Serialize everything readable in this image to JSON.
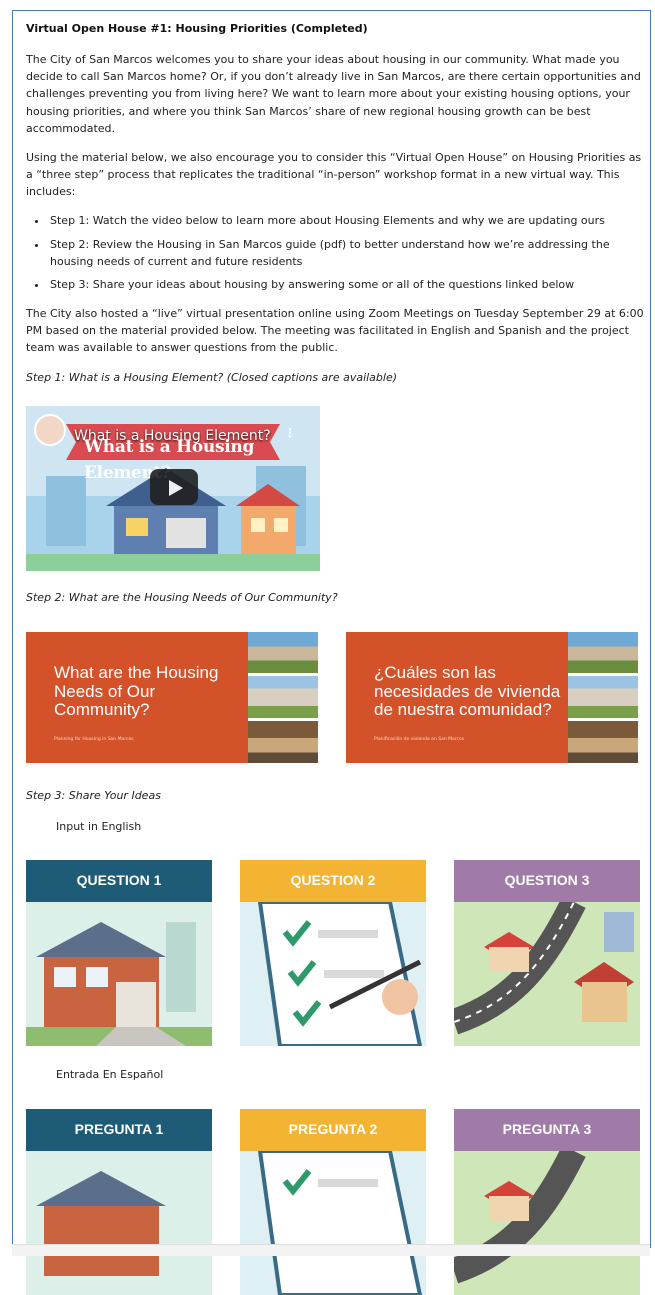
{
  "page": {
    "title": "Virtual Open House #1: Housing Priorities (Completed)",
    "intro": "The City of San Marcos welcomes you to share your ideas about housing in our community. What made you decide to call San Marcos home? Or, if you don’t already live in San Marcos, are there certain opportunities and challenges preventing you from living here? We want to learn more about your existing housing options, your housing priorities, and where you think San Marcos’ share of new regional housing growth can be best accommodated.",
    "process": "Using the material below, we also encourage you to consider this “Virtual Open House” on Housing Priorities as a “three step” process that replicates the traditional “in-person” workshop format in a new virtual way. This includes:",
    "steps": [
      "Step 1: Watch the video below to learn more about Housing Elements and why we are updating ours",
      "Step 2: Review the Housing in San Marcos guide (pdf) to better understand how we’re addressing the housing needs of current and future residents",
      "Step 3: Share your ideas about housing by answering some or all of the questions linked below"
    ],
    "live": "The City also hosted a “live” virtual presentation online using Zoom Meetings on Tuesday September 29 at 6:00 PM based on the material provided below. The meeting was facilitated in English and Spanish and the project team was available to answer questions from the public.",
    "step1_label": "Step 1: What is a Housing Element? (Closed captions are available)",
    "video": {
      "title": "What is a Housing Element?",
      "banner": "What is a Housing Element?",
      "menu": "⋮"
    },
    "step2_label": "Step 2: What are the Housing Needs of Our Community?",
    "guides": [
      {
        "title": "What are the Housing Needs of Our Community?",
        "subtitle": "Planning for Housing in San Marcos"
      },
      {
        "title": "¿Cuáles son las necesidades de vivienda de nuestra comunidad?",
        "subtitle": "Planificación de vivienda en San Marcos"
      }
    ],
    "step3_label": "Step 3: Share Your Ideas",
    "english_label": "Input in English",
    "english_cards": [
      "QUESTION 1",
      "QUESTION 2",
      "QUESTION 3"
    ],
    "spanish_label": "Entrada En Español",
    "spanish_cards": [
      "PREGUNTA 1",
      "PREGUNTA 2",
      "PREGUNTA 3"
    ]
  },
  "colors": {
    "card1": "#1d5b76",
    "card2": "#f3b333",
    "card3": "#a07ba8",
    "guide": "#d35229",
    "border": "#4a78b8"
  }
}
